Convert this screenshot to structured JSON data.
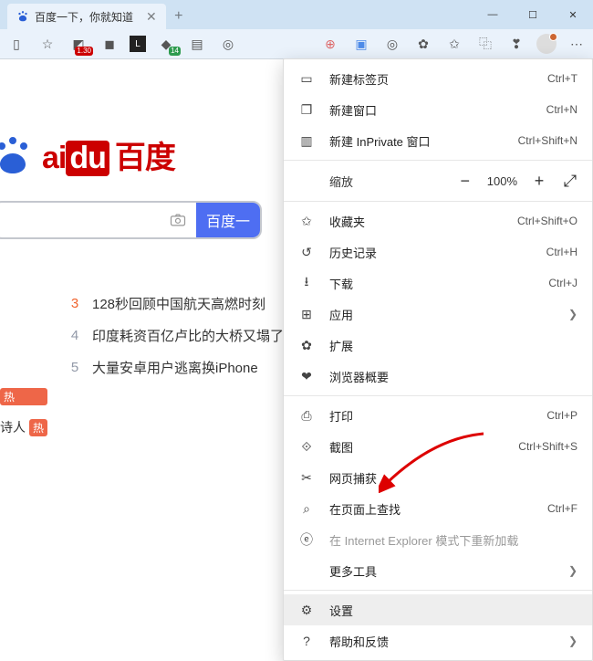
{
  "tab": {
    "title": "百度一下，你就知道"
  },
  "window_controls": {
    "min": "—",
    "max": "☐",
    "close": "✕"
  },
  "toolbar": {
    "badges": {
      "red": "1.30",
      "green": "14"
    }
  },
  "logo": {
    "en_left": "ai",
    "en_right": "du",
    "cn": "百度"
  },
  "search": {
    "camera": "⌕",
    "button_label": "百度一"
  },
  "hot": [
    {
      "rank": "3",
      "text": "128秒回顾中国航天高燃时刻",
      "top": true
    },
    {
      "rank": "4",
      "text": "印度耗资百亿卢比的大桥又塌了",
      "top": false
    },
    {
      "rank": "5",
      "text": "大量安卓用户逃离换iPhone",
      "top": false
    }
  ],
  "side_tags": [
    "热",
    "诗人",
    "热"
  ],
  "zoom": {
    "label": "缩放",
    "pct": "100%"
  },
  "menu": [
    {
      "type": "item",
      "icon": "tab",
      "label": "新建标签页",
      "shortcut": "Ctrl+T"
    },
    {
      "type": "item",
      "icon": "window",
      "label": "新建窗口",
      "shortcut": "Ctrl+N"
    },
    {
      "type": "item",
      "icon": "inprivate",
      "label": "新建 InPrivate 窗口",
      "shortcut": "Ctrl+Shift+N"
    },
    {
      "type": "sep"
    },
    {
      "type": "zoom"
    },
    {
      "type": "sep"
    },
    {
      "type": "item",
      "icon": "star",
      "label": "收藏夹",
      "shortcut": "Ctrl+Shift+O"
    },
    {
      "type": "item",
      "icon": "history",
      "label": "历史记录",
      "shortcut": "Ctrl+H"
    },
    {
      "type": "item",
      "icon": "download",
      "label": "下载",
      "shortcut": "Ctrl+J"
    },
    {
      "type": "item",
      "icon": "apps",
      "label": "应用",
      "chevron": true
    },
    {
      "type": "item",
      "icon": "ext",
      "label": "扩展"
    },
    {
      "type": "item",
      "icon": "perf",
      "label": "浏览器概要"
    },
    {
      "type": "sep"
    },
    {
      "type": "item",
      "icon": "print",
      "label": "打印",
      "shortcut": "Ctrl+P"
    },
    {
      "type": "item",
      "icon": "capture",
      "label": "截图",
      "shortcut": "Ctrl+Shift+S"
    },
    {
      "type": "item",
      "icon": "webcap",
      "label": "网页捕获"
    },
    {
      "type": "item",
      "icon": "find",
      "label": "在页面上查找",
      "shortcut": "Ctrl+F"
    },
    {
      "type": "item",
      "icon": "ie",
      "label": "在 Internet Explorer 模式下重新加载",
      "disabled": true
    },
    {
      "type": "item",
      "icon": "",
      "label": "更多工具",
      "chevron": true
    },
    {
      "type": "sep"
    },
    {
      "type": "item",
      "icon": "gear",
      "label": "设置",
      "highlight": true
    },
    {
      "type": "item",
      "icon": "help",
      "label": "帮助和反馈",
      "chevron": true
    }
  ],
  "icon_glyphs": {
    "tab": "▭",
    "window": "❐",
    "inprivate": "▥",
    "star": "✩",
    "history": "↺",
    "download": "⭳",
    "apps": "⊞",
    "ext": "✿",
    "perf": "❤",
    "print": "⎙",
    "capture": "⟐",
    "webcap": "✂",
    "find": "⌕",
    "ie": "ⓔ",
    "gear": "⚙",
    "help": "?"
  }
}
